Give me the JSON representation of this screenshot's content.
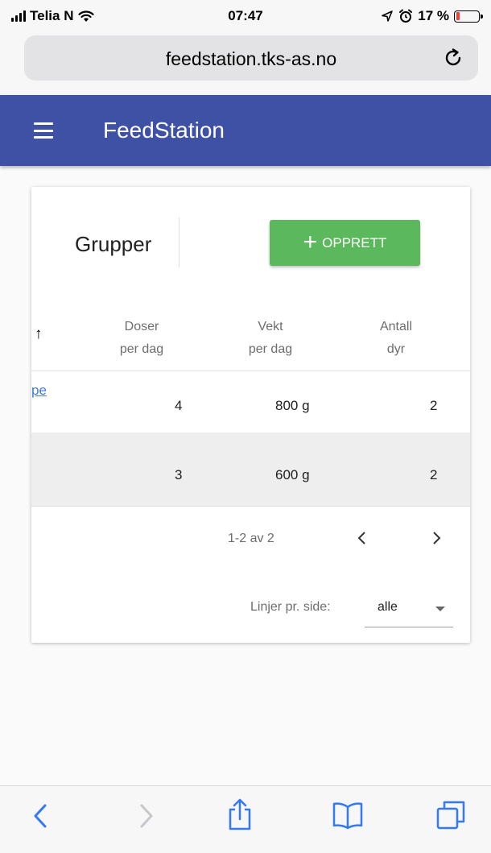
{
  "status_bar": {
    "carrier": "Telia N",
    "time": "07:47",
    "battery": "17 %",
    "battery_level": 0.17
  },
  "browser": {
    "url": "feedstation.tks-as.no"
  },
  "app_bar": {
    "title": "FeedStation"
  },
  "card": {
    "title": "Grupper",
    "create_button": {
      "icon": "+",
      "label": "OPPRETT"
    }
  },
  "table": {
    "sort_icon": "↑",
    "headers": [
      {
        "line1": "Doser",
        "line2": "per dag"
      },
      {
        "line1": "Vekt",
        "line2": "per dag"
      },
      {
        "line1": "Antall",
        "line2": "dyr"
      }
    ],
    "rows": [
      {
        "name_fragment": "pe",
        "doses": "4",
        "weight": "800 g",
        "animals": "2"
      },
      {
        "name_fragment": "",
        "doses": "3",
        "weight": "600 g",
        "animals": "2"
      }
    ]
  },
  "pagination": {
    "range": "1-2 av 2",
    "rows_label": "Linjer pr. side:",
    "rows_value": "alle"
  },
  "colors": {
    "app_bar": "#3f51a5",
    "create_button": "#5cb85c",
    "link": "#3f7bd6",
    "ios_blue": "#3478f6"
  }
}
